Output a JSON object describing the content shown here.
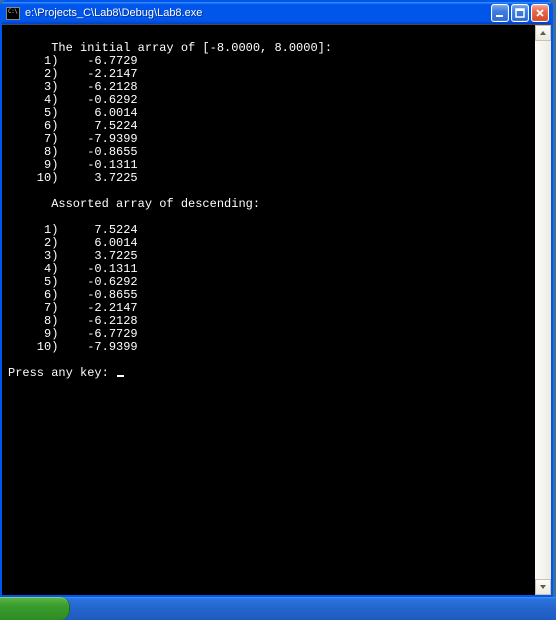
{
  "window": {
    "title": "e:\\Projects_C\\Lab8\\Debug\\Lab8.exe"
  },
  "console": {
    "header1": "      The initial array of [-8.0000, 8.0000]:",
    "initial": [
      {
        "idx": " 1",
        "val": "  -6.7729"
      },
      {
        "idx": " 2",
        "val": "  -2.2147"
      },
      {
        "idx": " 3",
        "val": "  -6.2128"
      },
      {
        "idx": " 4",
        "val": "  -0.6292"
      },
      {
        "idx": " 5",
        "val": "   6.0014"
      },
      {
        "idx": " 6",
        "val": "   7.5224"
      },
      {
        "idx": " 7",
        "val": "  -7.9399"
      },
      {
        "idx": " 8",
        "val": "  -0.8655"
      },
      {
        "idx": " 9",
        "val": "  -0.1311"
      },
      {
        "idx": "10",
        "val": "   3.7225"
      }
    ],
    "header2": "      Assorted array of descending:",
    "sorted": [
      {
        "idx": " 1",
        "val": "   7.5224"
      },
      {
        "idx": " 2",
        "val": "   6.0014"
      },
      {
        "idx": " 3",
        "val": "   3.7225"
      },
      {
        "idx": " 4",
        "val": "  -0.1311"
      },
      {
        "idx": " 5",
        "val": "  -0.6292"
      },
      {
        "idx": " 6",
        "val": "  -0.8655"
      },
      {
        "idx": " 7",
        "val": "  -2.2147"
      },
      {
        "idx": " 8",
        "val": "  -6.2128"
      },
      {
        "idx": " 9",
        "val": "  -6.7729"
      },
      {
        "idx": "10",
        "val": "  -7.9399"
      }
    ],
    "prompt": "Press any key: "
  }
}
